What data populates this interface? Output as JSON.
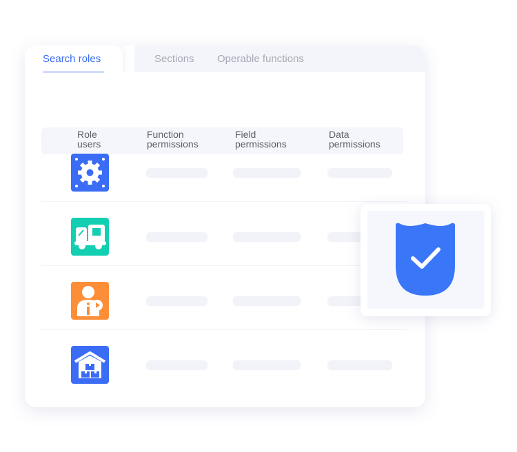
{
  "tabs": [
    {
      "label": "Search roles",
      "active": true
    },
    {
      "label": "Sections",
      "active": false
    },
    {
      "label": "Operable functions",
      "active": false
    }
  ],
  "table": {
    "headers": [
      [
        "Role",
        "users"
      ],
      [
        "Function",
        "permissions"
      ],
      [
        "Field",
        "permissions"
      ],
      [
        "Data",
        "permissions"
      ]
    ],
    "rows": [
      {
        "icon": "gear-icon",
        "color": "#3a6cf6"
      },
      {
        "icon": "delivery-truck-icon",
        "color": "#13cfb2"
      },
      {
        "icon": "user-info-icon",
        "color": "#fd8e38"
      },
      {
        "icon": "warehouse-icon",
        "color": "#3a6cf6"
      }
    ]
  },
  "badge": {
    "icon": "shield-check-icon",
    "color": "#3a76f8"
  },
  "colors": {
    "accent": "#3a6cf6"
  }
}
